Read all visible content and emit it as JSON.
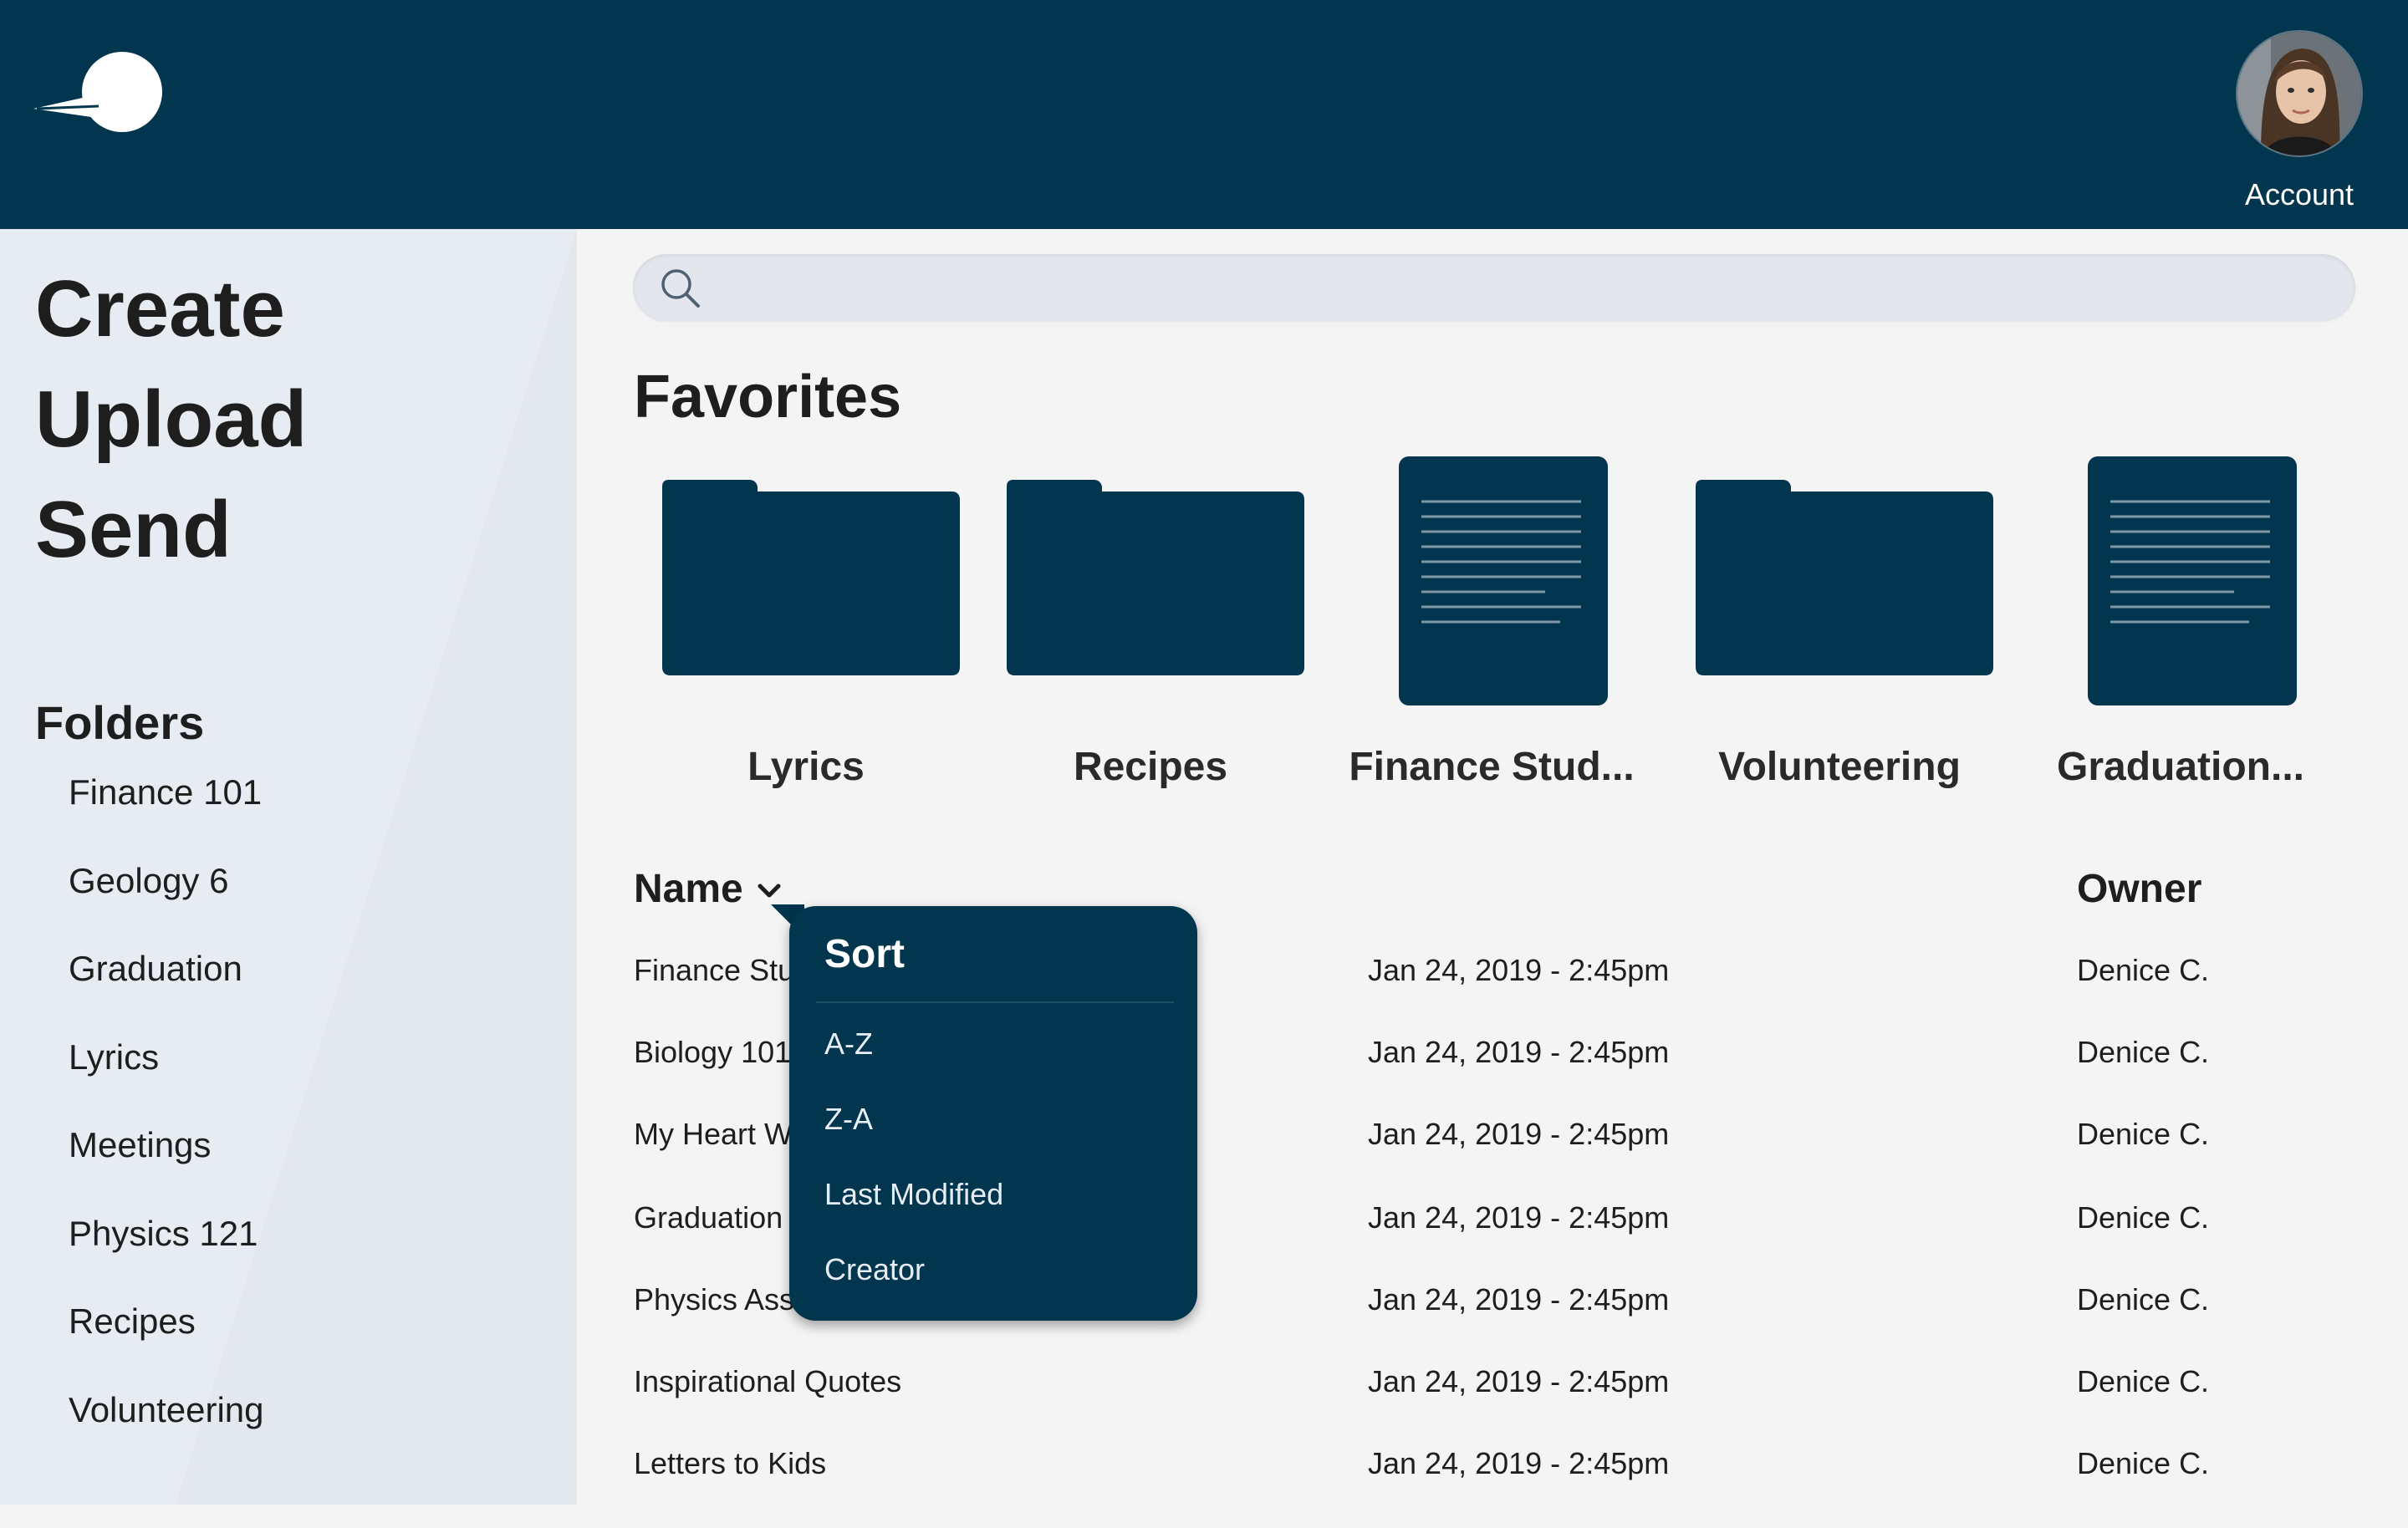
{
  "header": {
    "account_label": "Account"
  },
  "sidebar": {
    "actions": [
      "Create",
      "Upload",
      "Send"
    ],
    "folders_title": "Folders",
    "folders": [
      "Finance 101",
      "Geology 6",
      "Graduation",
      "Lyrics",
      "Meetings",
      "Physics 121",
      "Recipes",
      "Volunteering"
    ]
  },
  "search": {
    "placeholder": "",
    "value": ""
  },
  "favorites": {
    "title": "Favorites",
    "items": [
      {
        "label": "Lyrics",
        "kind": "folder-icon"
      },
      {
        "label": "Recipes",
        "kind": "folder-icon"
      },
      {
        "label": "Finance Stud...",
        "kind": "document-icon"
      },
      {
        "label": "Volunteering",
        "kind": "folder-icon"
      },
      {
        "label": "Graduation...",
        "kind": "document-icon"
      }
    ]
  },
  "table": {
    "col_name": "Name",
    "col_owner": "Owner",
    "rows": [
      {
        "name": "Finance Stu",
        "date": "Jan 24, 2019 - 2:45pm",
        "owner": "Denice C."
      },
      {
        "name": "Biology 101",
        "date": "Jan 24, 2019 - 2:45pm",
        "owner": "Denice C."
      },
      {
        "name": "My Heart W",
        "date": "Jan 24, 2019 - 2:45pm",
        "owner": "Denice C."
      },
      {
        "name": "Graduation",
        "date": "Jan 24, 2019 - 2:45pm",
        "owner": "Denice C."
      },
      {
        "name": "Physics Ass",
        "date": "Jan 24, 2019 - 2:45pm",
        "owner": "Denice C."
      },
      {
        "name": "Inspirational Quotes",
        "date": "Jan 24, 2019 - 2:45pm",
        "owner": "Denice C."
      },
      {
        "name": "Letters to Kids",
        "date": "Jan 24, 2019 - 2:45pm",
        "owner": "Denice C."
      }
    ]
  },
  "sort_menu": {
    "title": "Sort",
    "options": [
      "A-Z",
      "Z-A",
      "Last Modified",
      "Creator"
    ]
  },
  "colors": {
    "primary": "#02354e",
    "sidebar_bg": "#e7ebf2",
    "page_bg": "#f4f4f4"
  }
}
